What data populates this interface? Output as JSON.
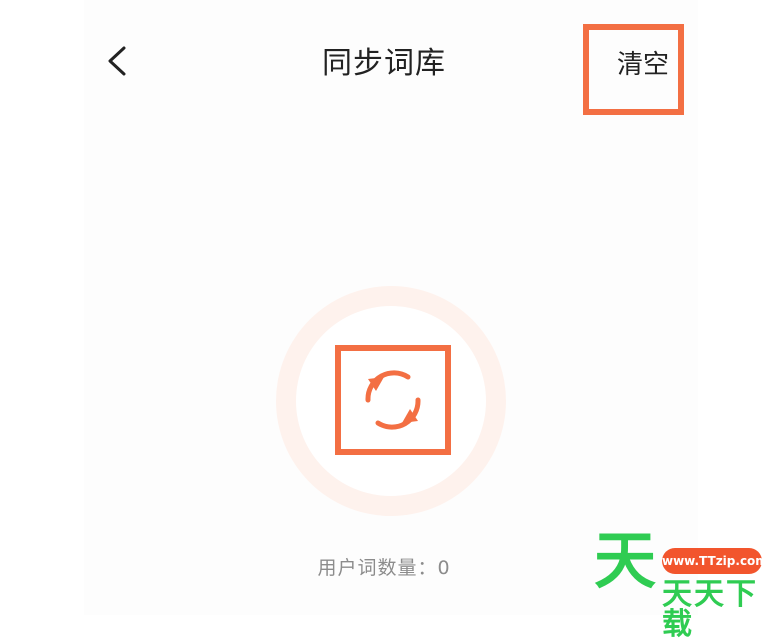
{
  "header": {
    "back_icon": "chevron-left-icon",
    "title": "同步词库",
    "clear_label": "清空"
  },
  "sync": {
    "icon": "sync-icon",
    "accent_color": "#f36f43",
    "ring_color": "#fef2ed"
  },
  "stats": {
    "user_word_count_label": "用户词数量：",
    "user_word_count": "0"
  },
  "watermark": {
    "big_char": "天",
    "url": "www.TTzip.com",
    "text": "天天下载"
  }
}
